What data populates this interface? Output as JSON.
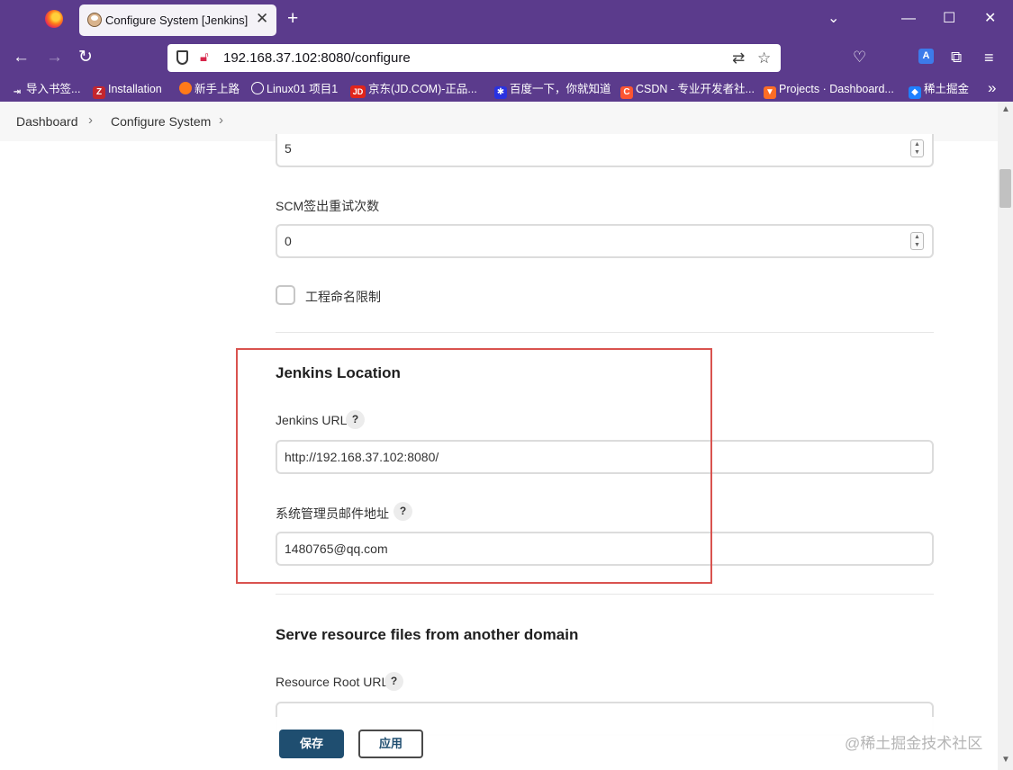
{
  "browser": {
    "tab_title": "Configure System [Jenkins]",
    "tab_close_glyph": "✕",
    "new_tab_glyph": "+",
    "url": "192.168.37.102:8080/configure",
    "window_controls": [
      "⌄",
      "—",
      "☐",
      "✕"
    ]
  },
  "bookmarks": [
    {
      "label": "导入书签...",
      "icon": "import-icon",
      "color": "#5b3b8c"
    },
    {
      "label": "Installation",
      "icon": "Z",
      "color": "#c4262e"
    },
    {
      "label": "新手上路",
      "icon": "firefox-icon",
      "color": "#ff7a1a"
    },
    {
      "label": "Linux01 项目1",
      "icon": "globe-icon",
      "color": "#5b3b8c"
    },
    {
      "label": "京东(JD.COM)-正品...",
      "icon": "JD",
      "color": "#e1251b"
    },
    {
      "label": "百度一下，你就知道",
      "icon": "paw-icon",
      "color": "#2932e1"
    },
    {
      "label": "CSDN - 专业开发者社...",
      "icon": "C",
      "color": "#fc5531"
    },
    {
      "label": "Projects · Dashboard...",
      "icon": "gitlab-icon",
      "color": "#fc6d26"
    },
    {
      "label": "稀土掘金",
      "icon": "juejin-icon",
      "color": "#1e80ff"
    }
  ],
  "breadcrumb": {
    "items": [
      "Dashboard",
      "Configure System"
    ],
    "separator": "›"
  },
  "form": {
    "top_field_value": "5",
    "scm_retry_label": "SCM签出重试次数",
    "scm_retry_value": "0",
    "project_naming_label": "工程命名限制",
    "jenkins_location": {
      "title": "Jenkins Location",
      "url_label": "Jenkins URL",
      "url_value": "http://192.168.37.102:8080/",
      "email_label": "系统管理员邮件地址",
      "email_value": "1480765@qq.com"
    },
    "resource": {
      "title": "Serve resource files from another domain",
      "root_url_label": "Resource Root URL"
    },
    "help_glyph": "?"
  },
  "buttons": {
    "save": "保存",
    "apply": "应用"
  },
  "watermark": "@稀土掘金技术社区",
  "colors": {
    "browser_chrome": "#5b3b8c",
    "save_button": "#1f4e70",
    "highlight": "#d9534f"
  }
}
